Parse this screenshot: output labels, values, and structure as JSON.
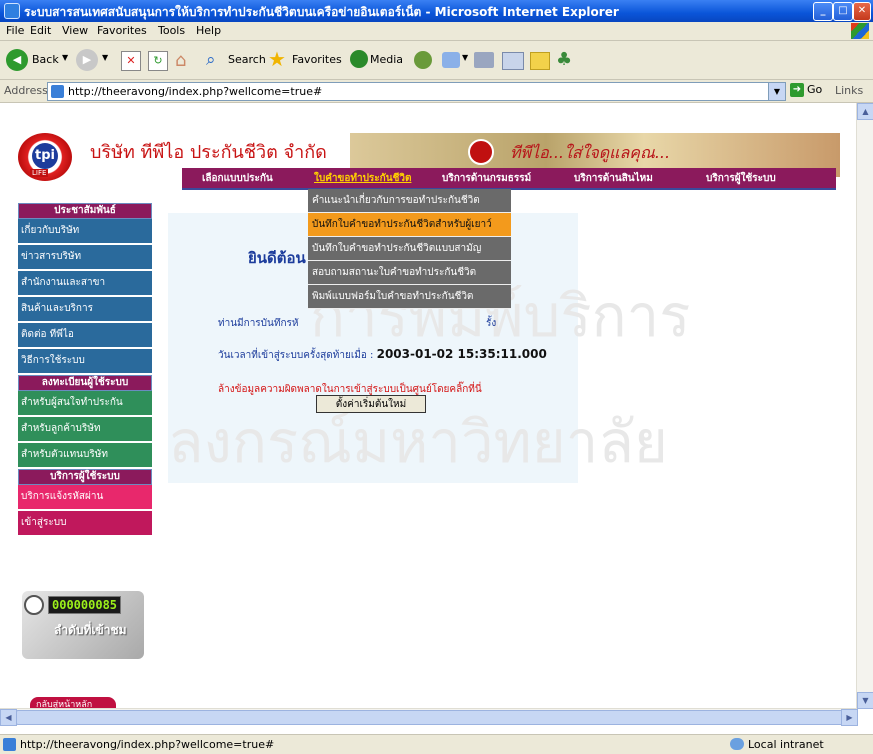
{
  "window": {
    "title": "ระบบสารสนเทศสนับสนุนการให้บริการทำประกันชีวิตบนเครือข่ายอินเตอร์เน็ต - Microsoft Internet Explorer"
  },
  "menu": [
    "File",
    "Edit",
    "View",
    "Favorites",
    "Tools",
    "Help"
  ],
  "toolbar": {
    "back_label": "Back",
    "search_label": "Search",
    "favorites_label": "Favorites",
    "media_label": "Media"
  },
  "address": {
    "label": "Address",
    "url": "http://theeravong/index.php?wellcome=true#",
    "go_label": "Go",
    "links_label": "Links"
  },
  "page": {
    "company_name": "บริษัท ทีพีไอ ประกันชีวิต จำกัด",
    "slogan": "ทีพีไอ...ใส่ใจดูแลคุณ...",
    "logo_text": "tpi",
    "logo_sub": "LIFE",
    "nav": [
      "เลือกแบบประกัน",
      "ใบคำขอทำประกันชีวิต",
      "บริการด้านกรมธรรม์",
      "บริการด้านสินไหม",
      "บริการผู้ใช้ระบบ"
    ],
    "dropdown": [
      "คำแนะนำเกี่ยวกับการขอทำประกันชีวิต",
      "บันทึกใบคำขอทำประกันชีวิตสำหรับผู้เยาว์",
      "บันทึกใบคำขอทำประกันชีวิตแบบสามัญ",
      "สอบถามสถานะใบคำขอทำประกันชีวิต",
      "พิมพ์แบบฟอร์มใบคำขอทำประกันชีวิต"
    ],
    "sidebar": {
      "head1": "ประชาสัมพันธ์",
      "items1": [
        "เกี่ยวกับบริษัท",
        "ข่าวสารบริษัท",
        "สำนักงานและสาขา",
        "สินค้าและบริการ",
        "ติดต่อ ทีพีไอ",
        "วิธีการใช้ระบบ"
      ],
      "head2": "ลงทะเบียนผู้ใช้ระบบ",
      "items2": [
        "สำหรับผู้สนใจทำประกัน",
        "สำหรับลูกค้าบริษัท",
        "สำหรับตัวแทนบริษัท"
      ],
      "head3": "บริการผู้ใช้ระบบ",
      "items3": [
        "บริการแจ้งรหัสผ่าน",
        "เข้าสู่ระบบ"
      ]
    },
    "counter": {
      "value": "000000085",
      "label": "ลำดับที่เข้าชม"
    },
    "home_button": "กลับสู่หน้าหลัก",
    "welcome": "ยินดีต้อน",
    "message_start": "ท่านมีการบันทึกรหั",
    "message_end": "รั้ง",
    "last_login_label": "วันเวลาที่เข้าสู่ระบบครั้งสุดท้ายเมื่อ :",
    "last_login_value": "2003-01-02 15:35:11.000",
    "error_message": "ล้างข้อมูลความผิดพลาดในการเข้าสู่ระบบเป็นศูนย์โดยคลิ๊กที่นี่",
    "reset_button": "ตั้งค่าเริ่มต้นใหม่",
    "watermark1": "การพิมพ์บริการ",
    "watermark2": "ลงกรณ์มหาวิทยาลัย"
  },
  "status": {
    "url": "http://theeravong/index.php?wellcome=true#",
    "zone": "Local intranet"
  }
}
